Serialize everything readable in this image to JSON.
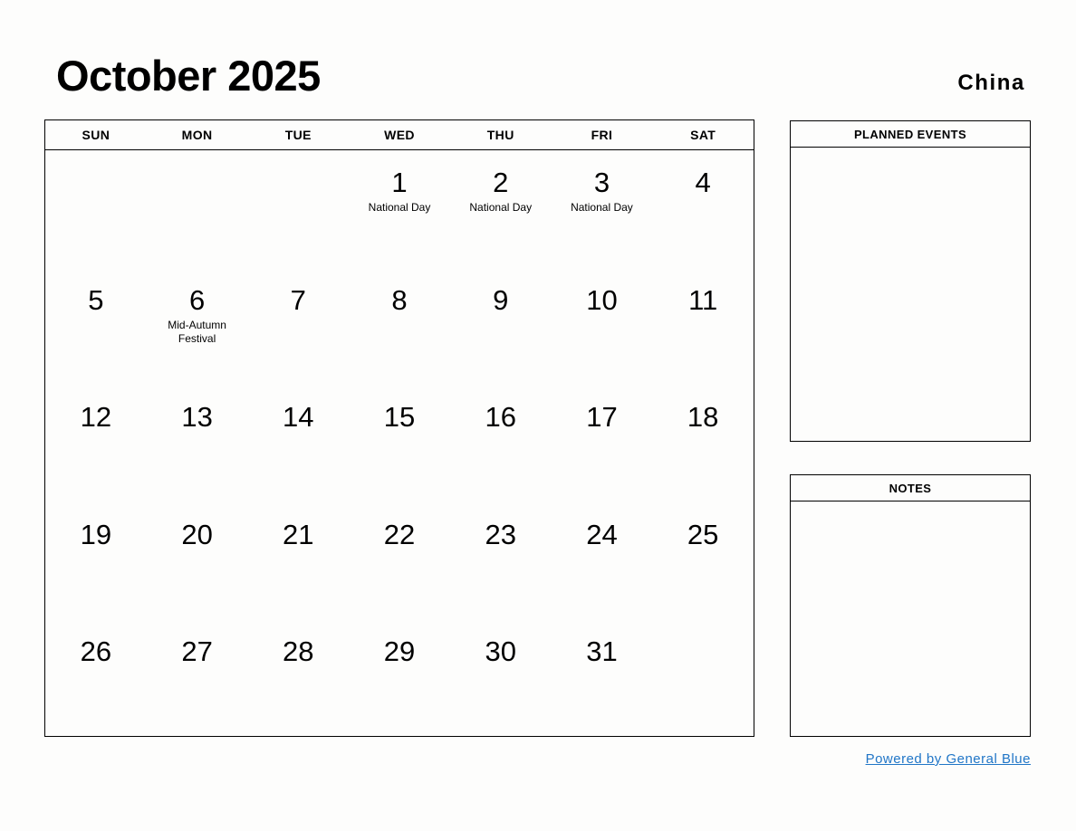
{
  "header": {
    "title": "October 2025",
    "country": "China"
  },
  "calendar": {
    "weekdays": [
      "SUN",
      "MON",
      "TUE",
      "WED",
      "THU",
      "FRI",
      "SAT"
    ],
    "weeks": [
      [
        {
          "day": "",
          "event": ""
        },
        {
          "day": "",
          "event": ""
        },
        {
          "day": "",
          "event": ""
        },
        {
          "day": "1",
          "event": "National Day"
        },
        {
          "day": "2",
          "event": "National Day"
        },
        {
          "day": "3",
          "event": "National Day"
        },
        {
          "day": "4",
          "event": ""
        }
      ],
      [
        {
          "day": "5",
          "event": ""
        },
        {
          "day": "6",
          "event": "Mid-Autumn Festival"
        },
        {
          "day": "7",
          "event": ""
        },
        {
          "day": "8",
          "event": ""
        },
        {
          "day": "9",
          "event": ""
        },
        {
          "day": "10",
          "event": ""
        },
        {
          "day": "11",
          "event": ""
        }
      ],
      [
        {
          "day": "12",
          "event": ""
        },
        {
          "day": "13",
          "event": ""
        },
        {
          "day": "14",
          "event": ""
        },
        {
          "day": "15",
          "event": ""
        },
        {
          "day": "16",
          "event": ""
        },
        {
          "day": "17",
          "event": ""
        },
        {
          "day": "18",
          "event": ""
        }
      ],
      [
        {
          "day": "19",
          "event": ""
        },
        {
          "day": "20",
          "event": ""
        },
        {
          "day": "21",
          "event": ""
        },
        {
          "day": "22",
          "event": ""
        },
        {
          "day": "23",
          "event": ""
        },
        {
          "day": "24",
          "event": ""
        },
        {
          "day": "25",
          "event": ""
        }
      ],
      [
        {
          "day": "26",
          "event": ""
        },
        {
          "day": "27",
          "event": ""
        },
        {
          "day": "28",
          "event": ""
        },
        {
          "day": "29",
          "event": ""
        },
        {
          "day": "30",
          "event": ""
        },
        {
          "day": "31",
          "event": ""
        },
        {
          "day": "",
          "event": ""
        }
      ]
    ]
  },
  "panels": {
    "planned_events": {
      "title": "PLANNED EVENTS",
      "content": ""
    },
    "notes": {
      "title": "NOTES",
      "content": ""
    }
  },
  "footer": {
    "link_text": "Powered by General Blue",
    "link_color": "#2176c7"
  }
}
